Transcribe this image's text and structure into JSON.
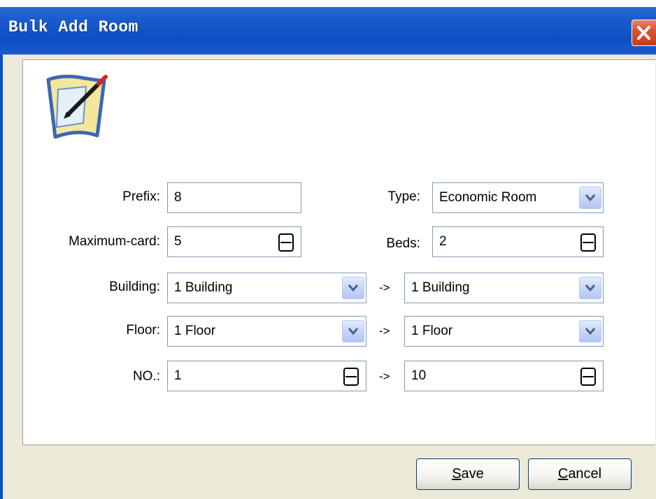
{
  "window": {
    "title": "Bulk Add Room"
  },
  "form": {
    "prefix": {
      "label": "Prefix:",
      "value": "8"
    },
    "type": {
      "label": "Type:",
      "value": "Economic Room"
    },
    "maximum_card": {
      "label": "Maximum-card:",
      "value": "5"
    },
    "beds": {
      "label": "Beds:",
      "value": "2"
    },
    "building": {
      "label": "Building:",
      "from": "1 Building",
      "separator": "->",
      "to": "1 Building"
    },
    "floor": {
      "label": "Floor:",
      "from": "1 Floor",
      "separator": "->",
      "to": "1 Floor"
    },
    "number": {
      "label": "NO.:",
      "from": "1",
      "separator": "->",
      "to": "10"
    }
  },
  "buttons": {
    "save": {
      "mnemonic": "S",
      "rest": "ave"
    },
    "cancel": {
      "mnemonic": "C",
      "rest": "ancel"
    }
  },
  "icons": {
    "dialog": "edit-document-icon",
    "close": "close-icon",
    "dropdown": "chevron-down-icon",
    "spinner": "spin-up-down-icon"
  },
  "colors": {
    "titlebar": "#0c4fc2",
    "close_button": "#d6512f",
    "dialog_background": "#ece9d8",
    "field_border": "#7f9db9",
    "combo_button": "#c6d6f8"
  }
}
